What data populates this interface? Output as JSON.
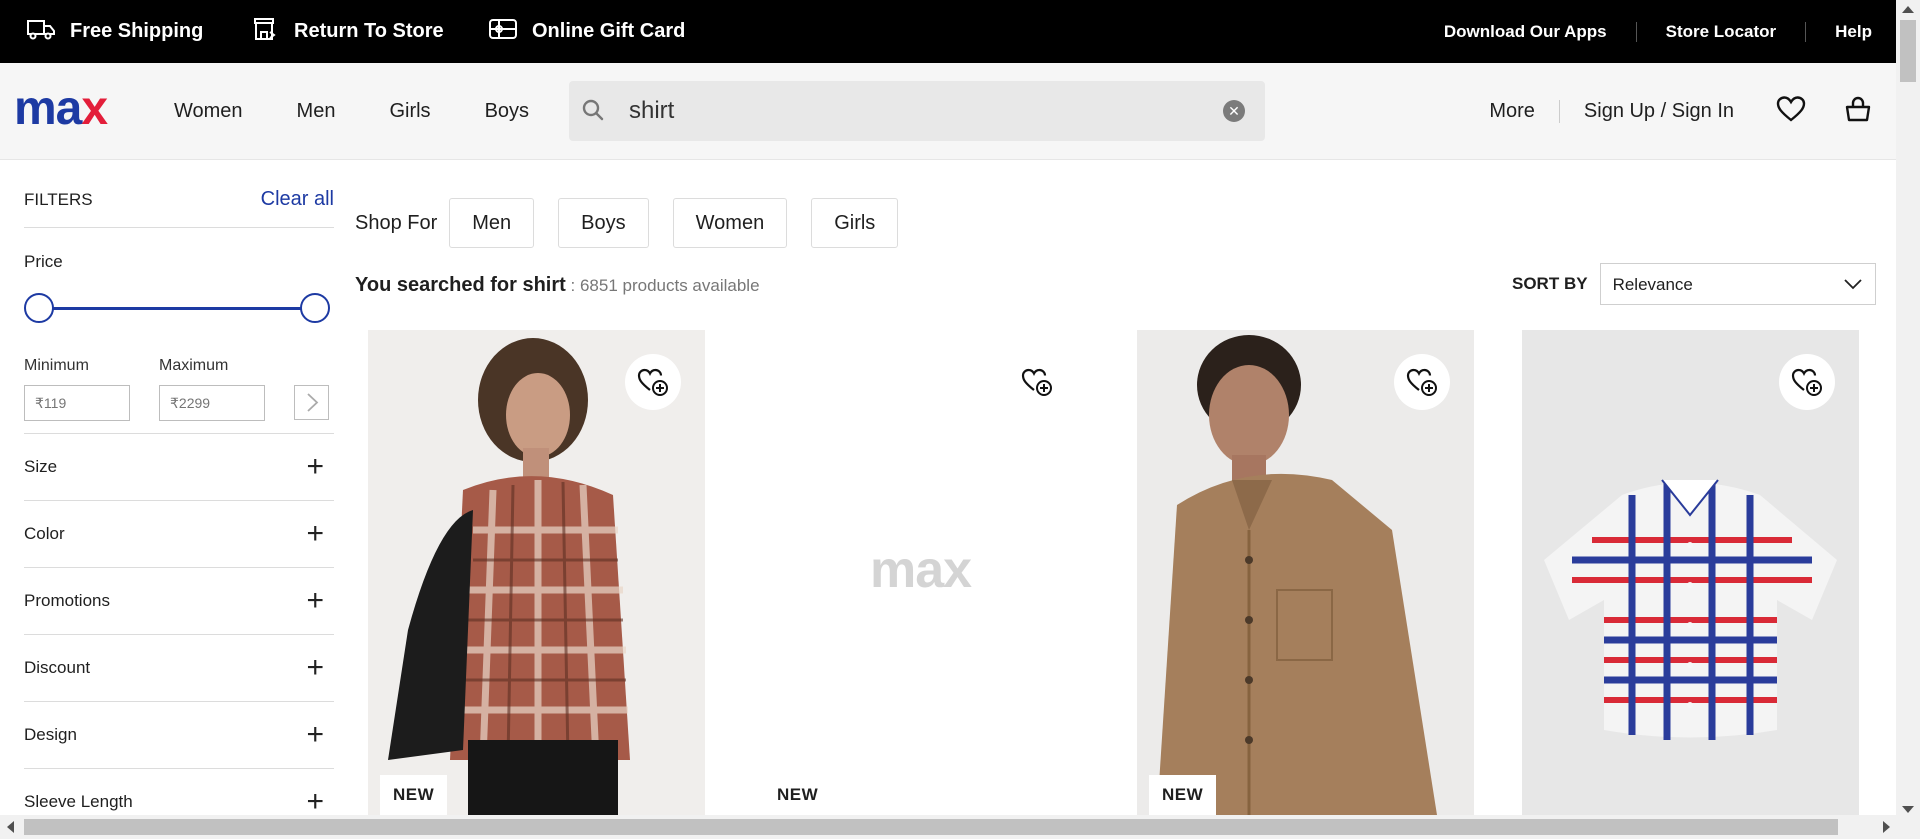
{
  "topbar": {
    "left": [
      {
        "label": "Free Shipping",
        "icon": "truck-icon"
      },
      {
        "label": "Return To Store",
        "icon": "store-return-icon"
      },
      {
        "label": "Online Gift Card",
        "icon": "gift-card-icon"
      }
    ],
    "right": [
      "Download Our Apps",
      "Store Locator",
      "Help"
    ]
  },
  "header": {
    "logo_part1": "ma",
    "logo_part2": "x",
    "nav": [
      "Women",
      "Men",
      "Girls",
      "Boys"
    ],
    "search_value": "shirt",
    "more": "More",
    "signin": "Sign Up / Sign In"
  },
  "filters": {
    "title": "FILTERS",
    "clear_all": "Clear all",
    "price_label": "Price",
    "min_label": "Minimum",
    "max_label": "Maximum",
    "min_placeholder": "₹119",
    "max_placeholder": "₹2299",
    "sections": [
      "Size",
      "Color",
      "Promotions",
      "Discount",
      "Design",
      "Sleeve Length"
    ],
    "plus": "+"
  },
  "shop_for": {
    "label": "Shop For",
    "chips": [
      "Men",
      "Boys",
      "Women",
      "Girls"
    ]
  },
  "results": {
    "prefix": "You searched for shirt",
    "count": " : 6851 products available"
  },
  "sort": {
    "label": "SORT BY",
    "value": "Relevance"
  },
  "products": [
    {
      "badge": "NEW",
      "image": "woman-plaid-shirt"
    },
    {
      "badge": "NEW",
      "image": "max-logo-placeholder",
      "placeholder_logo": "max"
    },
    {
      "badge": "NEW",
      "image": "boy-corduroy-shirt"
    },
    {
      "badge": "",
      "image": "kids-checked-shirt"
    }
  ],
  "colors": {
    "brand_blue": "#1d3aa3",
    "brand_red": "#e31e3a",
    "topbar_bg": "#000000"
  }
}
